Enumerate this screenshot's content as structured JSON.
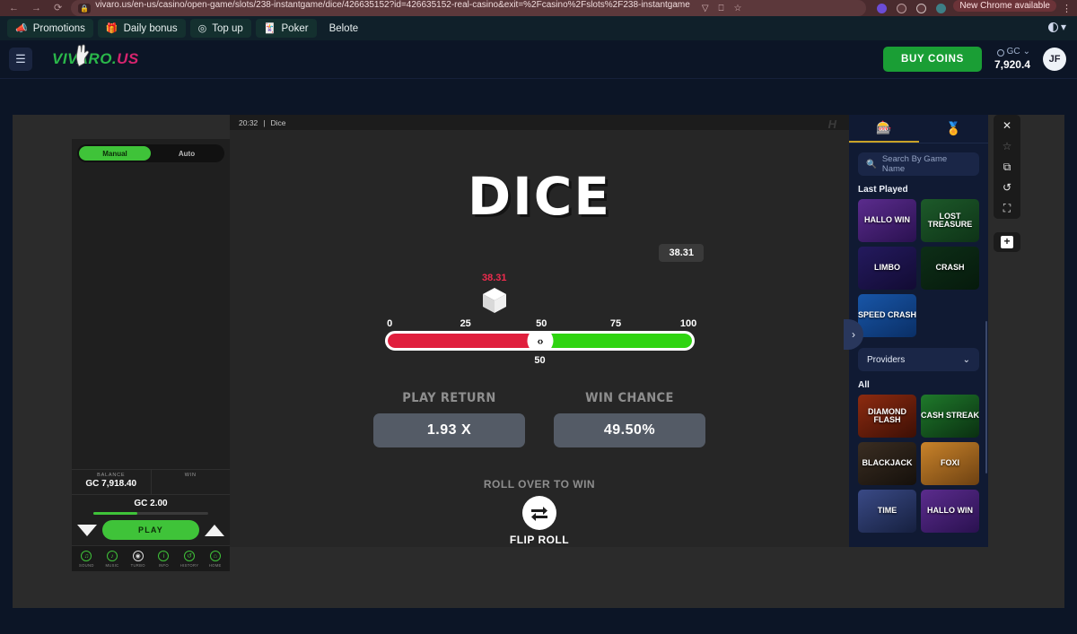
{
  "browser": {
    "back_icon": "←",
    "forward_icon": "→",
    "reload_icon": "⟳",
    "url": "vivaro.us/en-us/casino/open-game/slots/238-instantgame/dice/426635152?id=426635152-real-casino&exit=%2Fcasino%2Fslots%2F238-instantgame",
    "lock_icon": "lock-icon",
    "share_icon": "▽",
    "cast_icon": "⎕",
    "bookmark_icon": "☆",
    "update_pill": "New Chrome available",
    "kebab_icon": "⋮"
  },
  "promo_bar": {
    "items": [
      {
        "label": "Promotions",
        "icon": "📣"
      },
      {
        "label": "Daily bonus",
        "icon": "🎁"
      },
      {
        "label": "Top up",
        "icon": "◎"
      },
      {
        "label": "Poker",
        "icon": "🃏"
      },
      {
        "label": "Belote",
        "icon": ""
      }
    ]
  },
  "header": {
    "menu_icon": "☰",
    "logo_part1": "VIVARO",
    "logo_dot": ".",
    "logo_part2": "US",
    "theme_icon": "contrast-icon",
    "theme_caret": "▾",
    "buy_coins_label": "BUY COINS",
    "currency_label": "GC",
    "currency_caret": "⌄",
    "balance": "7,920.4",
    "avatar_initials": "JF"
  },
  "left_panel": {
    "mode_manual": "Manual",
    "mode_auto": "Auto",
    "balance_label": "BALANCE",
    "balance_value": "GC 7,918.40",
    "win_label": "WIN",
    "win_value": "",
    "bet_amount": "GC 2.00",
    "decrease_icon": "▼",
    "increase_icon": "▲",
    "play_label": "PLAY",
    "tools": [
      {
        "label": "SOUND",
        "icon": "♫"
      },
      {
        "label": "MUSIC",
        "icon": "♪"
      },
      {
        "label": "TURBO",
        "icon": "◉"
      },
      {
        "label": "INFO",
        "icon": "i"
      },
      {
        "label": "HISTORY",
        "icon": "↺"
      },
      {
        "label": "HOME",
        "icon": "⌂"
      }
    ]
  },
  "game": {
    "clock": "20:32",
    "separator": "|",
    "name": "Dice",
    "title": "DICE",
    "result_badge": "38.31",
    "cursor_value": "38.31",
    "slider_value": "50",
    "ticks": [
      "0",
      "25",
      "50",
      "75",
      "100"
    ],
    "knob_icon": "‹›",
    "play_return_label": "PLAY RETURN",
    "play_return_value": "1.93 X",
    "win_chance_label": "WIN CHANCE",
    "win_chance_value": "49.50%",
    "roll_direction_label": "ROLL OVER TO WIN",
    "flip_label": "FLIP ROLL",
    "flip_icon": "flip-arrows-icon",
    "watermark": "H",
    "color_low": "#e01f3d",
    "color_high": "#2fd411"
  },
  "sidebar": {
    "tab_slots_icon": "🎰",
    "tab_tournaments_icon": "🏅",
    "search_placeholder": "Search By Game Name",
    "search_icon": "🔍",
    "last_played_heading": "Last Played",
    "last_played": [
      {
        "title": "HALLO WIN",
        "bg": "linear-gradient(150deg,#5b2c8d,#2a1150)"
      },
      {
        "title": "LOST TREASURE",
        "bg": "linear-gradient(150deg,#1d5a2a,#0e3317)"
      },
      {
        "title": "LIMBO",
        "bg": "linear-gradient(150deg,#241a5e,#120b33)"
      },
      {
        "title": "CRASH",
        "bg": "linear-gradient(150deg,#0d2e17,#061a0c)"
      },
      {
        "title": "SPEED CRASH",
        "bg": "linear-gradient(150deg,#1856a8,#0a2f66)"
      }
    ],
    "providers_label": "Providers",
    "providers_caret": "⌄",
    "all_heading": "All",
    "all_games": [
      {
        "title": "DIAMOND FLASH",
        "bg": "linear-gradient(150deg,#8d2b10,#3d0f05)"
      },
      {
        "title": "CASH STREAK",
        "bg": "linear-gradient(150deg,#1f7a2b,#0a2f11)"
      },
      {
        "title": "BLACKJACK",
        "bg": "linear-gradient(150deg,#3a2d22,#15100b)"
      },
      {
        "title": "FOXI",
        "bg": "linear-gradient(150deg,#c9832a,#6d4112)"
      },
      {
        "title": "TIME",
        "bg": "linear-gradient(150deg,#3a4a86,#16203f)"
      },
      {
        "title": "HALLO WIN",
        "bg": "linear-gradient(150deg,#5b2c8d,#2a1150)"
      }
    ],
    "carousel_next_icon": "›"
  },
  "vtoolbar": {
    "close_icon": "✕",
    "favorite_icon": "☆",
    "duplicate_icon": "⧉",
    "refresh_icon": "↺",
    "fullscreen_icon": "⛶",
    "add_icon": "+"
  }
}
